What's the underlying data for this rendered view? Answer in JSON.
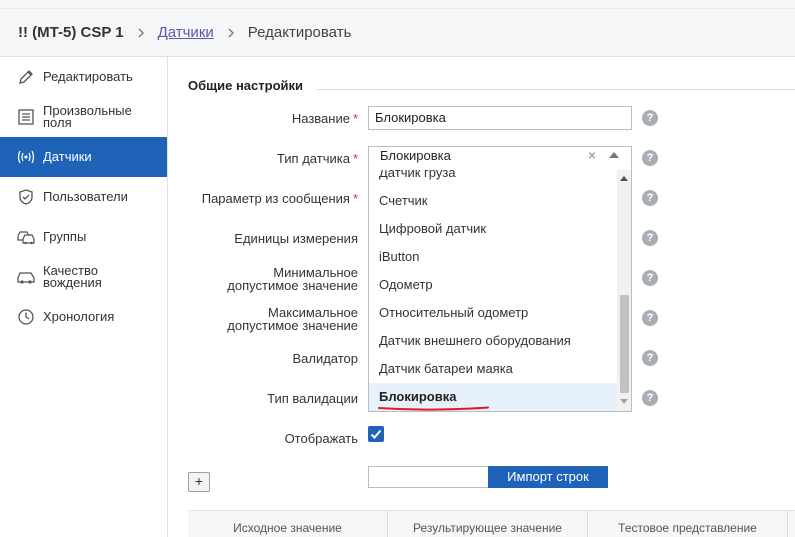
{
  "breadcrumb": {
    "unit": "!! (MT-5) CSP 1",
    "sensors_link": "Датчики",
    "current": "Редактировать"
  },
  "sidebar": {
    "items": [
      {
        "label": "Редактировать",
        "icon": "pencil-icon",
        "active": false
      },
      {
        "label": "Произвольные поля",
        "icon": "list-icon",
        "active": false
      },
      {
        "label": "Датчики",
        "icon": "sensor-icon",
        "active": true
      },
      {
        "label": "Пользователи",
        "icon": "shield-icon",
        "active": false
      },
      {
        "label": "Группы",
        "icon": "cars-group-icon",
        "active": false
      },
      {
        "label": "Качество вождения",
        "icon": "car-icon",
        "active": false
      },
      {
        "label": "Хронология",
        "icon": "clock-icon",
        "active": false
      }
    ]
  },
  "section": {
    "title": "Общие настройки"
  },
  "form": {
    "name_label": "Название",
    "name_value": "Блокировка",
    "type_label": "Тип датчика",
    "type_value": "Блокировка",
    "param_label": "Параметр из сообщения",
    "units_label": "Единицы измерения",
    "min_label_1": "Минимальное",
    "min_label_2": "допустимое значение",
    "max_label_1": "Максимальное",
    "max_label_2": "допустимое значение",
    "validator_label": "Валидатор",
    "validation_type_label": "Тип валидации",
    "display_label": "Отображать",
    "display_checked": true,
    "required_mark": "*",
    "help_glyph": "?"
  },
  "dropdown": {
    "options": [
      "Датчик груза",
      "Счетчик",
      "Цифровой датчик",
      "iButton",
      "Одометр",
      "Относительный одометр",
      "Датчик внешнего оборудования",
      "Датчик батареи маяка",
      "Блокировка"
    ],
    "selected": "Блокировка",
    "clear_glyph": "×"
  },
  "table": {
    "add_button": "+",
    "import_button": "Импорт строк",
    "columns": [
      "Исходное значение",
      "Результирующее значение",
      "Тестовое представление"
    ]
  },
  "colors": {
    "accent": "#1f63b8",
    "required": "#d9304a",
    "underline": "#e3192b"
  }
}
